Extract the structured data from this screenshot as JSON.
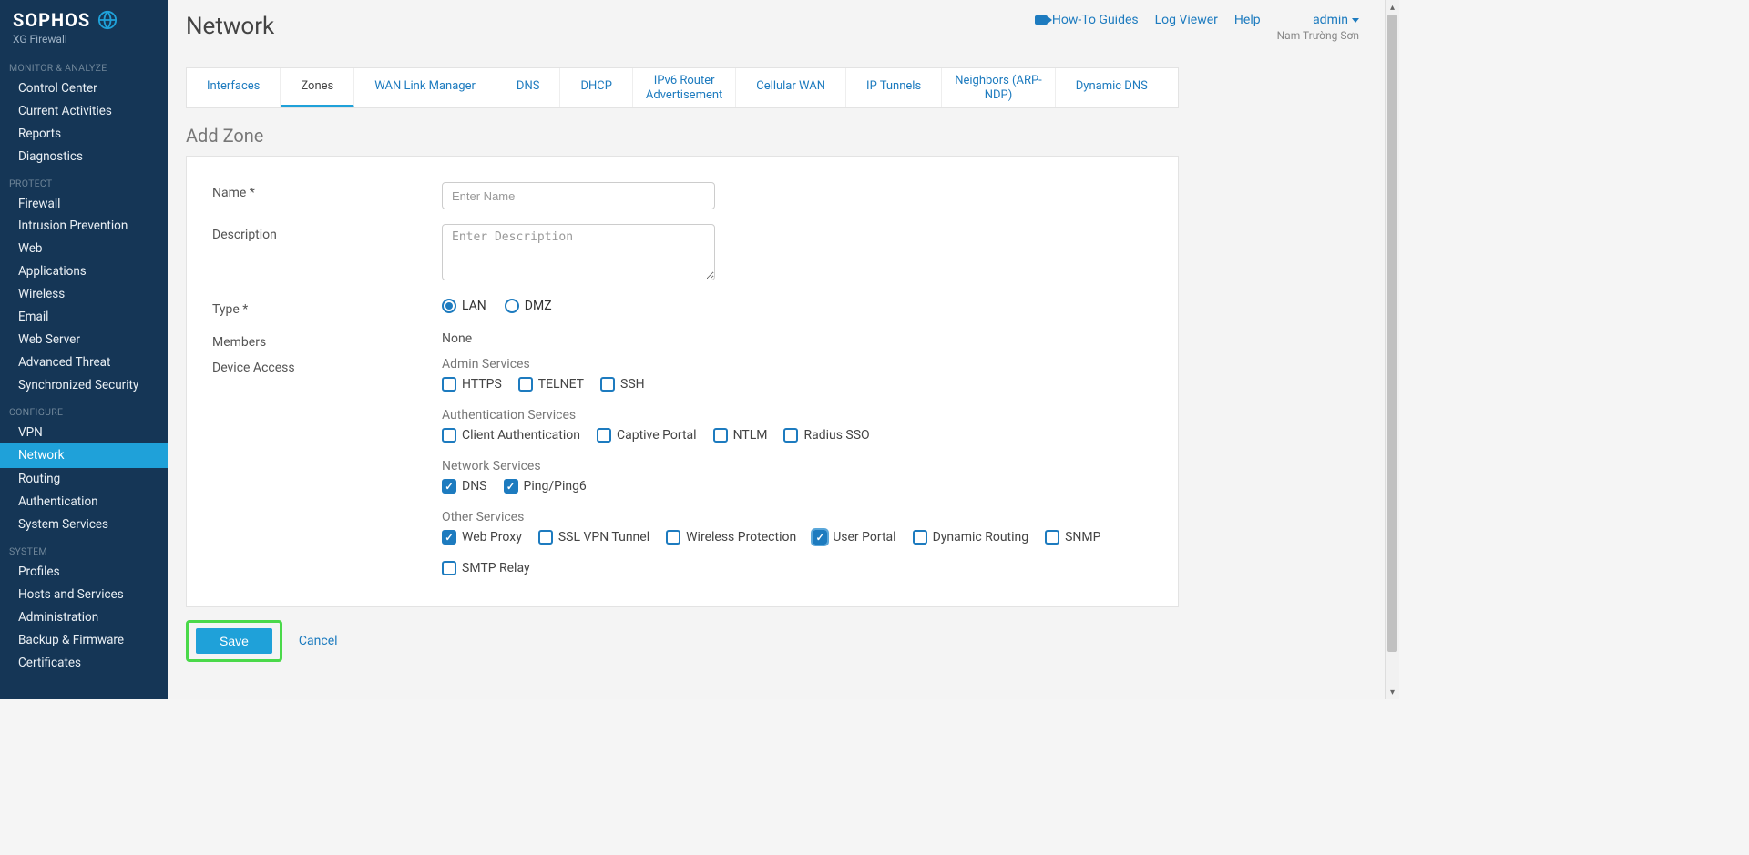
{
  "brand": {
    "wordmark": "SOPHOS",
    "subtitle": "XG Firewall"
  },
  "sidebar": {
    "sections": [
      {
        "title": "MONITOR & ANALYZE",
        "items": [
          "Control Center",
          "Current Activities",
          "Reports",
          "Diagnostics"
        ]
      },
      {
        "title": "PROTECT",
        "items": [
          "Firewall",
          "Intrusion Prevention",
          "Web",
          "Applications",
          "Wireless",
          "Email",
          "Web Server",
          "Advanced Threat",
          "Synchronized Security"
        ]
      },
      {
        "title": "CONFIGURE",
        "items": [
          "VPN",
          "Network",
          "Routing",
          "Authentication",
          "System Services"
        ],
        "activeIndex": 1
      },
      {
        "title": "SYSTEM",
        "items": [
          "Profiles",
          "Hosts and Services",
          "Administration",
          "Backup & Firmware",
          "Certificates"
        ]
      }
    ]
  },
  "header": {
    "title": "Network",
    "howto": "How-To Guides",
    "logviewer": "Log Viewer",
    "help": "Help",
    "admin": "admin",
    "company": "Nam Trường Sơn"
  },
  "tabs": [
    "Interfaces",
    "Zones",
    "WAN Link Manager",
    "DNS",
    "DHCP",
    "IPv6 Router Advertisement",
    "Cellular WAN",
    "IP Tunnels",
    "Neighbors (ARP-NDP)",
    "Dynamic DNS"
  ],
  "activeTab": 1,
  "page": {
    "subtitle": "Add Zone",
    "labels": {
      "name": "Name *",
      "description": "Description",
      "type": "Type *",
      "members": "Members",
      "members_value": "None",
      "device_access": "Device Access"
    },
    "placeholders": {
      "name": "Enter Name",
      "description": "Enter Description"
    },
    "type_options": {
      "lan": "LAN",
      "dmz": "DMZ",
      "selected": "lan"
    },
    "sections": {
      "admin": {
        "title": "Admin Services",
        "items": [
          {
            "label": "HTTPS",
            "checked": false
          },
          {
            "label": "TELNET",
            "checked": false
          },
          {
            "label": "SSH",
            "checked": false
          }
        ]
      },
      "auth": {
        "title": "Authentication Services",
        "items": [
          {
            "label": "Client Authentication",
            "checked": false
          },
          {
            "label": "Captive Portal",
            "checked": false
          },
          {
            "label": "NTLM",
            "checked": false
          },
          {
            "label": "Radius SSO",
            "checked": false
          }
        ]
      },
      "network": {
        "title": "Network Services",
        "items": [
          {
            "label": "DNS",
            "checked": true
          },
          {
            "label": "Ping/Ping6",
            "checked": true
          }
        ]
      },
      "other": {
        "title": "Other Services",
        "items": [
          {
            "label": "Web Proxy",
            "checked": true
          },
          {
            "label": "SSL VPN Tunnel",
            "checked": false
          },
          {
            "label": "Wireless Protection",
            "checked": false
          },
          {
            "label": "User Portal",
            "checked": true,
            "focused": true
          },
          {
            "label": "Dynamic Routing",
            "checked": false
          },
          {
            "label": "SNMP",
            "checked": false
          },
          {
            "label": "SMTP Relay",
            "checked": false
          }
        ]
      }
    },
    "actions": {
      "save": "Save",
      "cancel": "Cancel"
    }
  }
}
